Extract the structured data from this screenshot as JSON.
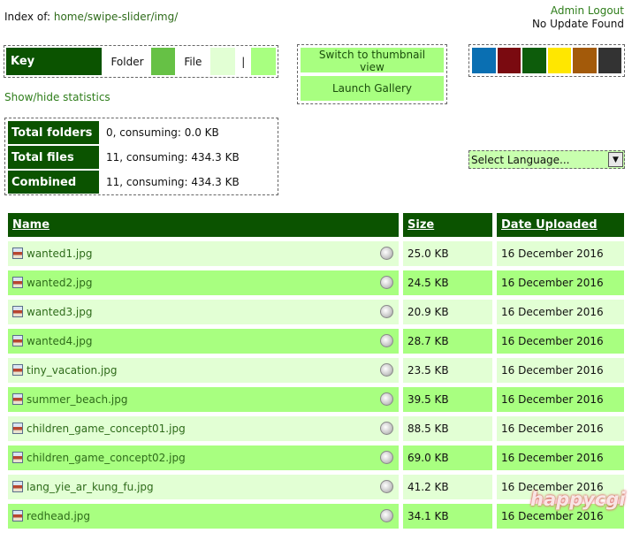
{
  "index": {
    "prefix": "Index of:",
    "path": "home/swipe-slider/img/"
  },
  "admin": {
    "logout": "Admin Logout",
    "update": "No Update Found"
  },
  "key": {
    "title": "Key",
    "folder_label": "Folder",
    "file_label": "File",
    "separator": "|"
  },
  "show_stats": "Show/hide statistics",
  "buttons": {
    "thumbnail": "Switch to thumbnail view",
    "gallery": "Launch Gallery"
  },
  "themes": [
    "#0a6fb2",
    "#7a0a10",
    "#0d5c0b",
    "#ffe700",
    "#a35a0a",
    "#333333"
  ],
  "stats": [
    {
      "label": "Total folders",
      "value": "0, consuming: 0.0 KB"
    },
    {
      "label": "Total files",
      "value": "11, consuming: 434.3 KB"
    },
    {
      "label": "Combined",
      "value": "11, consuming: 434.3 KB"
    }
  ],
  "language": "Select Language...",
  "table": {
    "headers": {
      "name": "Name",
      "size": "Size",
      "date": "Date Uploaded"
    },
    "rows": [
      {
        "name": "wanted1.jpg",
        "size": "25.0 KB",
        "date": "16 December 2016"
      },
      {
        "name": "wanted2.jpg",
        "size": "24.5 KB",
        "date": "16 December 2016"
      },
      {
        "name": "wanted3.jpg",
        "size": "20.9 KB",
        "date": "16 December 2016"
      },
      {
        "name": "wanted4.jpg",
        "size": "28.7 KB",
        "date": "16 December 2016"
      },
      {
        "name": "tiny_vacation.jpg",
        "size": "23.5 KB",
        "date": "16 December 2016"
      },
      {
        "name": "summer_beach.jpg",
        "size": "39.5 KB",
        "date": "16 December 2016"
      },
      {
        "name": "children_game_concept01.jpg",
        "size": "88.5 KB",
        "date": "16 December 2016"
      },
      {
        "name": "children_game_concept02.jpg",
        "size": "69.0 KB",
        "date": "16 December 2016"
      },
      {
        "name": "lang_yie_ar_kung_fu.jpg",
        "size": "41.2 KB",
        "date": "16 December 2016"
      },
      {
        "name": "redhead.jpg",
        "size": "34.1 KB",
        "date": "16 December 2016"
      }
    ]
  },
  "watermark": "happycgi"
}
